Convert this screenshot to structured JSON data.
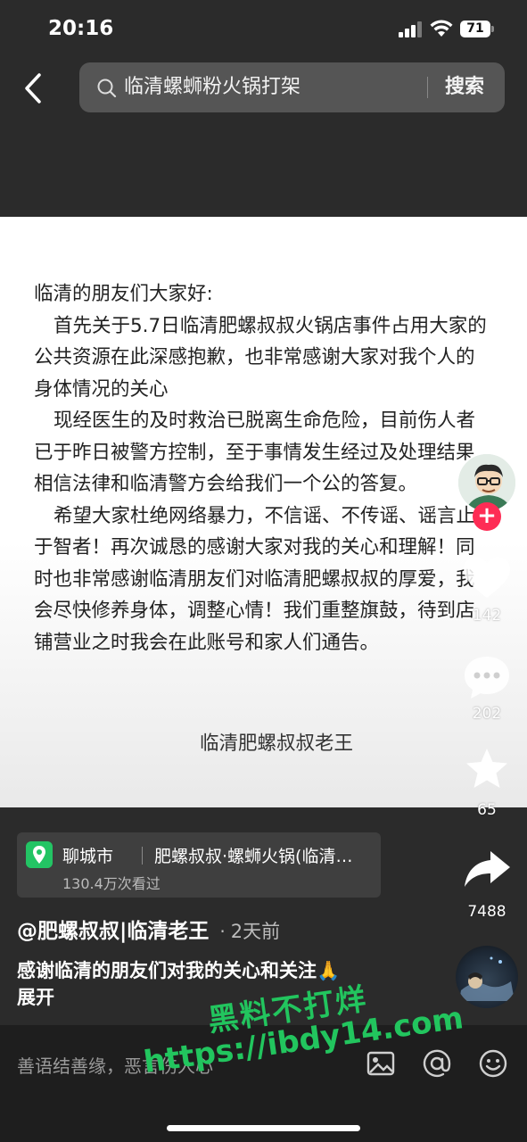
{
  "status_bar": {
    "time": "20:16",
    "battery": "71"
  },
  "header": {
    "search_query": "临清螺蛳粉火锅打架",
    "search_button": "搜索"
  },
  "post": {
    "letter": {
      "greeting": "临清的朋友们大家好:",
      "para1": "首先关于5.7日临清肥螺叔叔火锅店事件占用大家的公共资源在此深感抱歉，也非常感谢大家对我个人的身体情况的关心",
      "para2": "现经医生的及时救治已脱离生命危险，目前伤人者已于昨日被警方控制，至于事情发生经过及处理结果相信法律和临清警方会给我们一个公的答复。",
      "para3": "希望大家杜绝网络暴力，不信谣、不传谣、谣言止于智者！再次诚恳的感谢大家对我的关心和理解！同时也非常感谢临清朋友们对临清肥螺叔叔的厚爱，我会尽快修养身体，调整心情！我们重整旗鼓，待到店铺营业之时我会在此账号和家人们通告。",
      "signature": "临清肥螺叔叔老王"
    },
    "location": {
      "city": "聊城市",
      "place": "肥螺叔叔·螺蛳火锅(临清…",
      "views": "130.4万次看过"
    },
    "author": "@肥螺叔叔|临清老王",
    "separator": "·",
    "posted": "2天前",
    "caption": "感谢临清的朋友们对我的关心和关注🙏",
    "expand": "展开"
  },
  "rail": {
    "likes": "142",
    "comments": "202",
    "favorites": "65",
    "shares": "7488",
    "follow_symbol": "+"
  },
  "comment_bar": {
    "placeholder": "善语结善缘，恶言伤人心"
  },
  "watermark": {
    "line1": "黑料不打烊",
    "line2": "https://ibdy14.com"
  },
  "colors": {
    "accent_red": "#fe2c55",
    "location_green": "#23c464",
    "watermark_green": "#22c55e"
  }
}
